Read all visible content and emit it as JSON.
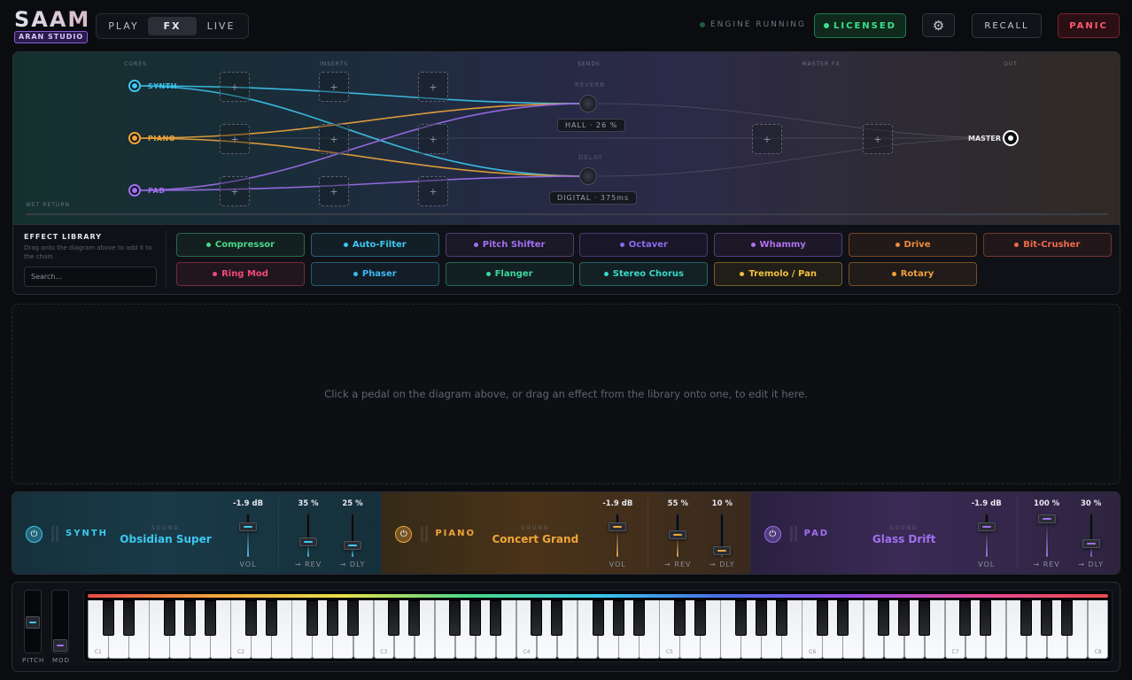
{
  "app": {
    "name": "SAAM",
    "studio": "ARAN STUDIO"
  },
  "modes": [
    "PLAY",
    "FX",
    "LIVE"
  ],
  "active_mode": "FX",
  "status": {
    "engine": "ENGINE RUNNING",
    "license": "LICENSED"
  },
  "toolbar": {
    "recall": "RECALL",
    "panic": "PANIC",
    "settings_icon": "gear-icon"
  },
  "routing": {
    "columns": [
      "CORES",
      "INSERTS",
      "SENDS",
      "MASTER FX",
      "OUT"
    ],
    "channels": [
      {
        "name": "SYNTH",
        "color": "#3cc8f0"
      },
      {
        "name": "PIANO",
        "color": "#f0a53a"
      },
      {
        "name": "PAD",
        "color": "#a070f0"
      }
    ],
    "slot_symbol": "+",
    "sends": [
      {
        "name": "REVERB",
        "tag": "HALL · 26 %"
      },
      {
        "name": "DELAY",
        "tag": "DIGITAL · 375ms"
      }
    ],
    "master": "MASTER",
    "wet_return": "WET RETURN"
  },
  "library": {
    "title": "EFFECT LIBRARY",
    "subtitle": "Drag onto the diagram above to add it to the chain",
    "search_placeholder": "Search...",
    "effects": [
      {
        "name": "Compressor",
        "color": "#4ad88a"
      },
      {
        "name": "Auto-Filter",
        "color": "#3cc8f0"
      },
      {
        "name": "Pitch Shifter",
        "color": "#a070f0"
      },
      {
        "name": "Octaver",
        "color": "#8a6af0"
      },
      {
        "name": "Whammy",
        "color": "#b070f0"
      },
      {
        "name": "Drive",
        "color": "#f08a3a"
      },
      {
        "name": "Bit-Crusher",
        "color": "#f06a4a"
      },
      {
        "name": "Ring Mod",
        "color": "#f04a7a"
      },
      {
        "name": "Phaser",
        "color": "#3cb8f0"
      },
      {
        "name": "Flanger",
        "color": "#3ad8a0"
      },
      {
        "name": "Stereo Chorus",
        "color": "#3ad8c8"
      },
      {
        "name": "Tremolo / Pan",
        "color": "#f0c03a"
      },
      {
        "name": "Rotary",
        "color": "#f0a03a"
      }
    ]
  },
  "editor": {
    "hint": "Click a pedal on the diagram above, or drag an effect from the library onto one, to edit it here."
  },
  "mixer": {
    "sound_header": "SOUND",
    "labels": {
      "vol": "VOL",
      "rev": "→ REV",
      "dly": "→ DLY"
    },
    "channels": [
      {
        "name": "SYNTH",
        "sound": "Obsidian Super",
        "vol": "-1.9 dB",
        "rev": "35 %",
        "dly": "25 %",
        "vol_level": 0.78,
        "rev_level": 0.35,
        "dly_level": 0.25,
        "color": "#3cc8f0"
      },
      {
        "name": "PIANO",
        "sound": "Concert Grand",
        "vol": "-1.9 dB",
        "rev": "55 %",
        "dly": "10 %",
        "vol_level": 0.78,
        "rev_level": 0.55,
        "dly_level": 0.1,
        "color": "#f0a53a"
      },
      {
        "name": "PAD",
        "sound": "Glass Drift",
        "vol": "-1.9 dB",
        "rev": "100 %",
        "dly": "30 %",
        "vol_level": 0.78,
        "rev_level": 1.0,
        "dly_level": 0.3,
        "color": "#a070f0"
      }
    ]
  },
  "keyboard": {
    "pitch_label": "PITCH",
    "mod_label": "MOD",
    "octave_labels": [
      "C1",
      "C2",
      "C3",
      "C4",
      "C5",
      "C6",
      "C7",
      "C8"
    ],
    "white_key_count": 50
  }
}
